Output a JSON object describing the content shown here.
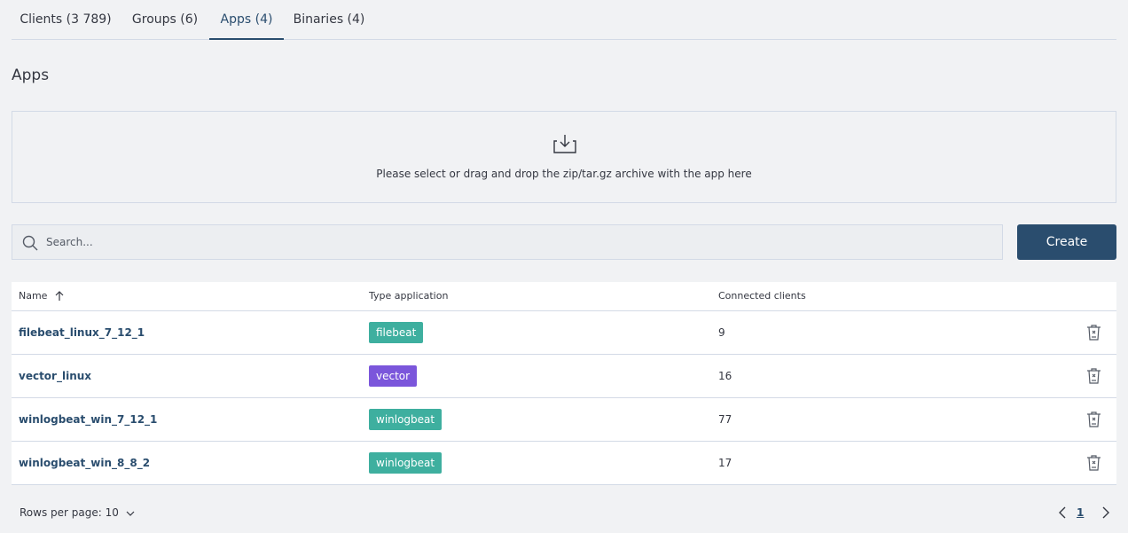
{
  "tabs": [
    {
      "label": "Clients (3 789)",
      "active": false
    },
    {
      "label": "Groups (6)",
      "active": false
    },
    {
      "label": "Apps (4)",
      "active": true
    },
    {
      "label": "Binaries (4)",
      "active": false
    }
  ],
  "page_title": "Apps",
  "dropzone": {
    "icon": "download-tray-icon",
    "text": "Please select or drag and drop the zip/tar.gz archive with the app here"
  },
  "search": {
    "placeholder": "Search...",
    "value": "",
    "icon": "search-icon"
  },
  "create_button": "Create",
  "table": {
    "columns": [
      "Name",
      "Type application",
      "Connected clients"
    ],
    "sort": {
      "column": "Name",
      "direction": "ascending"
    },
    "rows": [
      {
        "name": "filebeat_linux_7_12_1",
        "type": "filebeat",
        "clients": "9"
      },
      {
        "name": "vector_linux",
        "type": "vector",
        "clients": "16"
      },
      {
        "name": "winlogbeat_win_7_12_1",
        "type": "winlogbeat",
        "clients": "77"
      },
      {
        "name": "winlogbeat_win_8_8_2",
        "type": "winlogbeat",
        "clients": "17"
      }
    ]
  },
  "badge_colors": {
    "filebeat": "#3eaf9f",
    "vector": "#7b56db",
    "winlogbeat": "#3eaf9f"
  },
  "pagination": {
    "rows_per_page": "Rows per page: 10",
    "current_page": "1"
  }
}
